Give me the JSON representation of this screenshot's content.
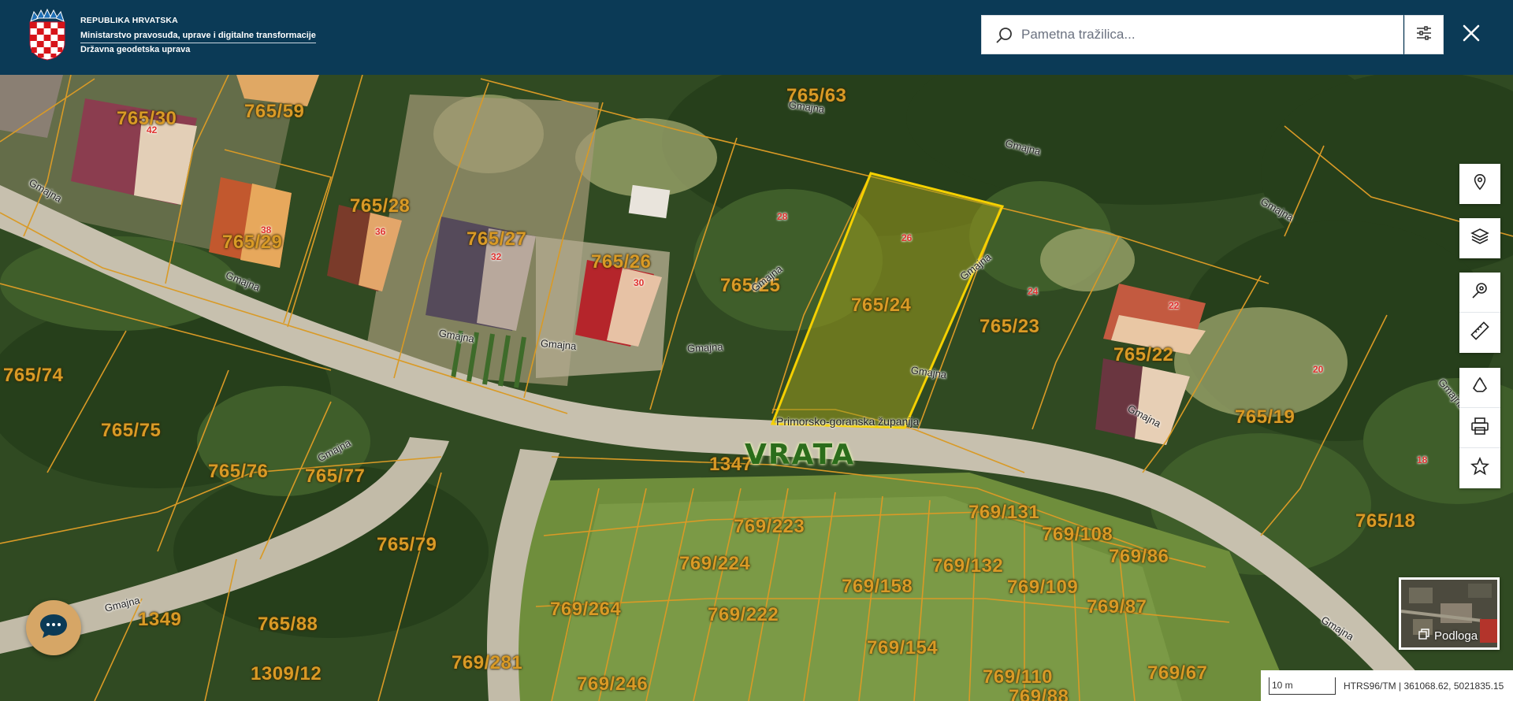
{
  "header": {
    "org_line1": "REPUBLIKA HRVATSKA",
    "org_line2": "Ministarstvo pravosuđa, uprave i digitalne transformacije",
    "org_line3": "Državna geodetska uprava",
    "search_placeholder": "Pametna tražilica..."
  },
  "icons": {
    "logo": "croatian-coat-of-arms-icon",
    "search": "search-icon",
    "filter": "sliders-icon",
    "close": "close-icon"
  },
  "toolbar": {
    "groups": [
      [
        "location-pin-icon"
      ],
      [
        "layers-icon"
      ],
      [
        "search-location-icon",
        "ruler-icon"
      ],
      [
        "recycle-icon",
        "print-icon",
        "star-icon"
      ]
    ]
  },
  "map": {
    "place_name": "VRATA",
    "county": "Primorsko-goranska županija",
    "selected_parcel": "765/24",
    "parcels": [
      "765/63",
      "765/30",
      "765/59",
      "765/28",
      "765/29",
      "765/27",
      "765/26",
      "765/25",
      "765/24",
      "765/23",
      "765/22",
      "765/19",
      "765/18",
      "765/74",
      "765/75",
      "765/76",
      "765/77",
      "765/79",
      "765/88",
      "1349",
      "1309/12",
      "1347",
      "769/223",
      "769/224",
      "769/222",
      "769/264",
      "769/281",
      "769/246",
      "769/158",
      "769/154",
      "769/132",
      "769/131",
      "769/108",
      "769/109",
      "769/86",
      "769/87",
      "769/110",
      "769/67",
      "769/88"
    ],
    "house_numbers": [
      "42",
      "38",
      "36",
      "32",
      "30",
      "28",
      "26",
      "24",
      "22",
      "20",
      "18"
    ],
    "street_name": "Gmajna"
  },
  "basemap": {
    "label": "Podloga"
  },
  "status": {
    "scale": "10 m",
    "coords": "HTRS96/TM | 361068.62, 5021835.15"
  },
  "colors": {
    "header_bg": "#0b3a56",
    "parcel_line": "#d99a26",
    "selected_outline": "#f5d000",
    "house_number": "#e0322f"
  }
}
